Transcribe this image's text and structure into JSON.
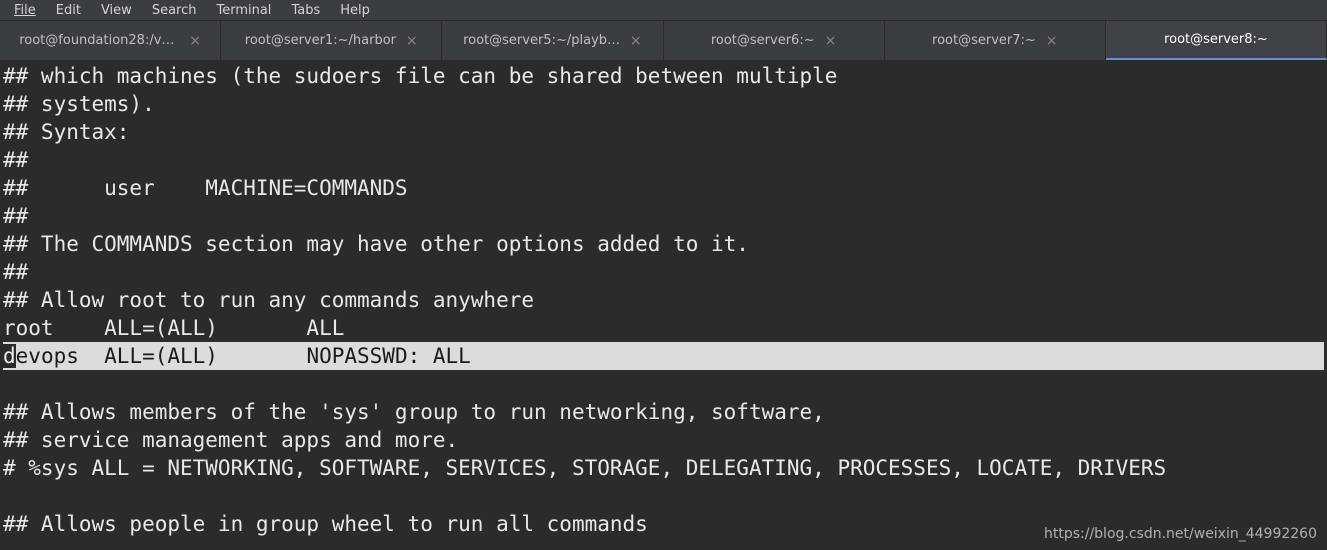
{
  "menubar": {
    "items": [
      "File",
      "Edit",
      "View",
      "Search",
      "Terminal",
      "Tabs",
      "Help"
    ]
  },
  "tabs": [
    {
      "label": "root@foundation28:/va…",
      "active": false,
      "closable": true
    },
    {
      "label": "root@server1:~/harbor",
      "active": false,
      "closable": true
    },
    {
      "label": "root@server5:~/playb…",
      "active": false,
      "closable": true
    },
    {
      "label": "root@server6:~",
      "active": false,
      "closable": true
    },
    {
      "label": "root@server7:~",
      "active": false,
      "closable": true
    },
    {
      "label": "root@server8:~",
      "active": true,
      "closable": false
    }
  ],
  "terminal": {
    "lines": [
      {
        "text": "## which machines (the sudoers file can be shared between multiple",
        "highlight": false
      },
      {
        "text": "## systems).",
        "highlight": false
      },
      {
        "text": "## Syntax:",
        "highlight": false
      },
      {
        "text": "##",
        "highlight": false
      },
      {
        "text": "##      user    MACHINE=COMMANDS",
        "highlight": false
      },
      {
        "text": "##",
        "highlight": false
      },
      {
        "text": "## The COMMANDS section may have other options added to it.",
        "highlight": false
      },
      {
        "text": "##",
        "highlight": false
      },
      {
        "text": "## Allow root to run any commands anywhere",
        "highlight": false
      },
      {
        "text": "root    ALL=(ALL)       ALL",
        "highlight": false
      },
      {
        "text": "devops  ALL=(ALL)       NOPASSWD: ALL",
        "highlight": true,
        "cursor_col": 0
      },
      {
        "text": "",
        "highlight": false
      },
      {
        "text": "## Allows members of the 'sys' group to run networking, software,",
        "highlight": false
      },
      {
        "text": "## service management apps and more.",
        "highlight": false
      },
      {
        "text": "# %sys ALL = NETWORKING, SOFTWARE, SERVICES, STORAGE, DELEGATING, PROCESSES, LOCATE, DRIVERS",
        "highlight": false
      },
      {
        "text": "",
        "highlight": false
      },
      {
        "text": "## Allows people in group wheel to run all commands",
        "highlight": false
      }
    ]
  },
  "watermark": "https://blog.csdn.net/weixin_44992260"
}
